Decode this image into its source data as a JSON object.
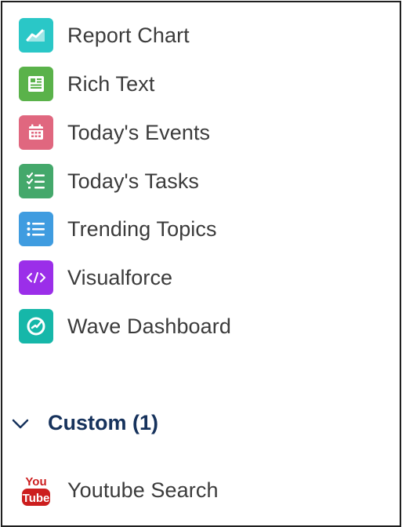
{
  "items": [
    {
      "label": "Report Chart",
      "icon": "line-chart-icon",
      "color": "#2ac7c7"
    },
    {
      "label": "Rich Text",
      "icon": "document-icon",
      "color": "#5ab24a"
    },
    {
      "label": "Today's Events",
      "icon": "calendar-icon",
      "color": "#e0677f"
    },
    {
      "label": "Today's Tasks",
      "icon": "task-list-icon",
      "color": "#44a86b"
    },
    {
      "label": "Trending Topics",
      "icon": "list-icon",
      "color": "#3f9ce0"
    },
    {
      "label": "Visualforce",
      "icon": "code-icon",
      "color": "#9b2ee9"
    },
    {
      "label": "Wave Dashboard",
      "icon": "gauge-icon",
      "color": "#16b7a9"
    }
  ],
  "custom_section": {
    "label": "Custom (1)",
    "expanded": true,
    "items": [
      {
        "label": "Youtube Search",
        "icon": "youtube-icon",
        "color": "#cc1e1e",
        "icon_text_top": "You",
        "icon_text_bottom": "Tube"
      }
    ]
  }
}
